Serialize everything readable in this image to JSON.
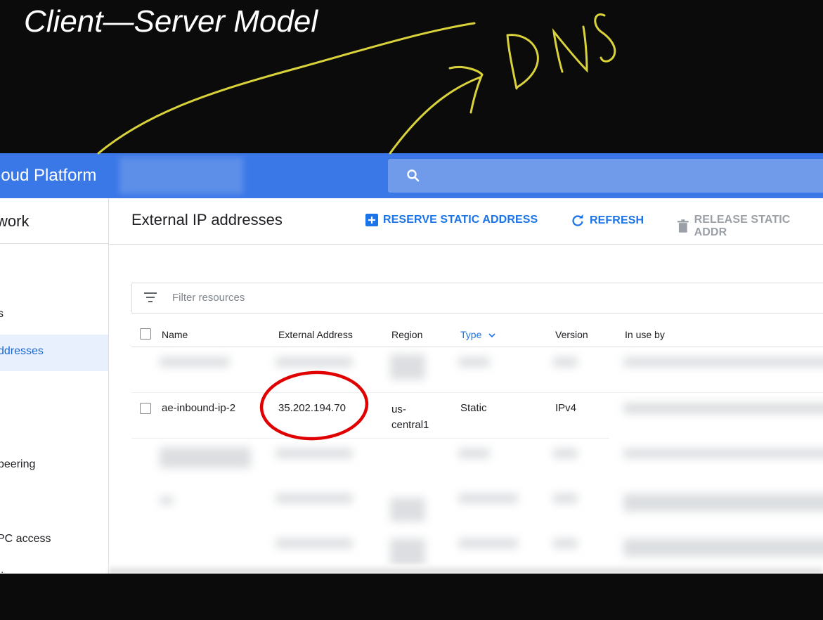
{
  "slide": {
    "title": "Client—Server Model",
    "handwritten_note": "DNS",
    "annotation_color": "#d9d23a",
    "highlight_color": "#e00000"
  },
  "header": {
    "brand": "loud Platform",
    "search_icon": "search-icon",
    "bar_color": "#3b78e7"
  },
  "sidebar": {
    "heading": "work",
    "items": [
      {
        "label": "s",
        "active": false
      },
      {
        "label": "ddresses",
        "active": true
      },
      {
        "label": "peering",
        "active": false
      },
      {
        "label": "PC access",
        "active": false
      },
      {
        "label": "ring",
        "active": false
      }
    ]
  },
  "page": {
    "title": "External IP addresses",
    "actions": {
      "reserve": "RESERVE STATIC ADDRESS",
      "refresh": "REFRESH",
      "release": "RELEASE STATIC ADDR"
    }
  },
  "filter": {
    "placeholder": "Filter resources"
  },
  "table": {
    "columns": [
      "Name",
      "External Address",
      "Region",
      "Type",
      "Version",
      "In use by"
    ],
    "sort_column": "Type",
    "visible_row": {
      "name": "ae-inbound-ip-2",
      "external_address": "35.202.194.70",
      "region": "us-central1",
      "region_line1": "us-",
      "region_line2": "central1",
      "type": "Static",
      "version": "IPv4"
    }
  }
}
